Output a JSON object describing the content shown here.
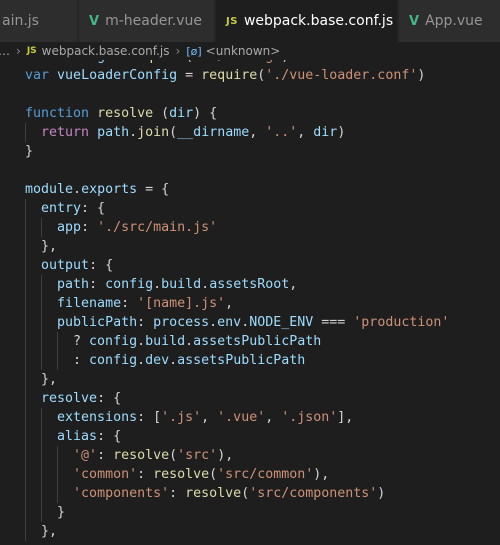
{
  "tabs": [
    {
      "label": "ain.js",
      "icon": "js-icon"
    },
    {
      "label": "m-header.vue",
      "icon": "vue-icon"
    },
    {
      "label": "webpack.base.conf.js",
      "icon": "js-icon",
      "active": true,
      "close": "✕"
    },
    {
      "label": "App.vue",
      "icon": "vue-icon"
    }
  ],
  "icons": {
    "js": "JS",
    "vue": "V"
  },
  "breadcrumb": {
    "lead": "…",
    "file": "webpack.base.conf.js",
    "symbol_icon": "[ø]",
    "symbol": "<unknown>"
  },
  "colors": {
    "keyword": "#569cd6",
    "control": "#c586c0",
    "function": "#dcdcaa",
    "variable": "#9cdcfe",
    "string": "#ce9178",
    "plain": "#d4d4d4",
    "background": "#1e1e1e"
  },
  "code_lines": [
    [
      [
        "k",
        "var"
      ],
      [
        "p",
        " "
      ],
      [
        "v",
        "config"
      ],
      [
        "p",
        " = "
      ],
      [
        "f",
        "require"
      ],
      [
        "p",
        "("
      ],
      [
        "s",
        "'../config'"
      ],
      [
        "p",
        ")"
      ]
    ],
    [
      [
        "k",
        "var"
      ],
      [
        "p",
        " "
      ],
      [
        "v",
        "vueLoaderConfig"
      ],
      [
        "p",
        " = "
      ],
      [
        "f",
        "require"
      ],
      [
        "p",
        "("
      ],
      [
        "s",
        "'./vue-loader.conf'"
      ],
      [
        "p",
        ")"
      ]
    ],
    [],
    [
      [
        "k",
        "function"
      ],
      [
        "p",
        " "
      ],
      [
        "f",
        "resolve"
      ],
      [
        "p",
        " ("
      ],
      [
        "v",
        "dir"
      ],
      [
        "p",
        ") {"
      ]
    ],
    [
      [
        "p",
        "  "
      ],
      [
        "c",
        "return"
      ],
      [
        "p",
        " "
      ],
      [
        "v",
        "path"
      ],
      [
        "p",
        "."
      ],
      [
        "f",
        "join"
      ],
      [
        "p",
        "("
      ],
      [
        "v",
        "__dirname"
      ],
      [
        "p",
        ", "
      ],
      [
        "s",
        "'..'"
      ],
      [
        "p",
        ", "
      ],
      [
        "v",
        "dir"
      ],
      [
        "p",
        ")"
      ]
    ],
    [
      [
        "p",
        "}"
      ]
    ],
    [],
    [
      [
        "v",
        "module"
      ],
      [
        "p",
        "."
      ],
      [
        "v",
        "exports"
      ],
      [
        "p",
        " = {"
      ]
    ],
    [
      [
        "p",
        "  "
      ],
      [
        "v",
        "entry"
      ],
      [
        "p",
        ": {"
      ]
    ],
    [
      [
        "p",
        "    "
      ],
      [
        "v",
        "app"
      ],
      [
        "p",
        ": "
      ],
      [
        "s",
        "'./src/main.js'"
      ]
    ],
    [
      [
        "p",
        "  },"
      ]
    ],
    [
      [
        "p",
        "  "
      ],
      [
        "v",
        "output"
      ],
      [
        "p",
        ": {"
      ]
    ],
    [
      [
        "p",
        "    "
      ],
      [
        "v",
        "path"
      ],
      [
        "p",
        ": "
      ],
      [
        "v",
        "config"
      ],
      [
        "p",
        "."
      ],
      [
        "v",
        "build"
      ],
      [
        "p",
        "."
      ],
      [
        "v",
        "assetsRoot"
      ],
      [
        "p",
        ","
      ]
    ],
    [
      [
        "p",
        "    "
      ],
      [
        "v",
        "filename"
      ],
      [
        "p",
        ": "
      ],
      [
        "s",
        "'[name].js'"
      ],
      [
        "p",
        ","
      ]
    ],
    [
      [
        "p",
        "    "
      ],
      [
        "v",
        "publicPath"
      ],
      [
        "p",
        ": "
      ],
      [
        "v",
        "process"
      ],
      [
        "p",
        "."
      ],
      [
        "v",
        "env"
      ],
      [
        "p",
        "."
      ],
      [
        "v",
        "NODE_ENV"
      ],
      [
        "p",
        " === "
      ],
      [
        "s",
        "'production'"
      ]
    ],
    [
      [
        "p",
        "      ? "
      ],
      [
        "v",
        "config"
      ],
      [
        "p",
        "."
      ],
      [
        "v",
        "build"
      ],
      [
        "p",
        "."
      ],
      [
        "v",
        "assetsPublicPath"
      ]
    ],
    [
      [
        "p",
        "      : "
      ],
      [
        "v",
        "config"
      ],
      [
        "p",
        "."
      ],
      [
        "v",
        "dev"
      ],
      [
        "p",
        "."
      ],
      [
        "v",
        "assetsPublicPath"
      ]
    ],
    [
      [
        "p",
        "  },"
      ]
    ],
    [
      [
        "p",
        "  "
      ],
      [
        "v",
        "resolve"
      ],
      [
        "p",
        ": {"
      ]
    ],
    [
      [
        "p",
        "    "
      ],
      [
        "v",
        "extensions"
      ],
      [
        "p",
        ": ["
      ],
      [
        "s",
        "'.js'"
      ],
      [
        "p",
        ", "
      ],
      [
        "s",
        "'.vue'"
      ],
      [
        "p",
        ", "
      ],
      [
        "s",
        "'.json'"
      ],
      [
        "p",
        "],"
      ]
    ],
    [
      [
        "p",
        "    "
      ],
      [
        "v",
        "alias"
      ],
      [
        "p",
        ": {"
      ]
    ],
    [
      [
        "p",
        "      "
      ],
      [
        "s",
        "'@'"
      ],
      [
        "p",
        ": "
      ],
      [
        "f",
        "resolve"
      ],
      [
        "p",
        "("
      ],
      [
        "s",
        "'src'"
      ],
      [
        "p",
        "),"
      ]
    ],
    [
      [
        "p",
        "      "
      ],
      [
        "s",
        "'common'"
      ],
      [
        "p",
        ": "
      ],
      [
        "f",
        "resolve"
      ],
      [
        "p",
        "("
      ],
      [
        "s",
        "'src/common'"
      ],
      [
        "p",
        "),"
      ]
    ],
    [
      [
        "p",
        "      "
      ],
      [
        "s",
        "'components'"
      ],
      [
        "p",
        ": "
      ],
      [
        "f",
        "resolve"
      ],
      [
        "p",
        "("
      ],
      [
        "s",
        "'src/components'"
      ],
      [
        "p",
        ")"
      ]
    ],
    [
      [
        "p",
        "    }"
      ]
    ],
    [
      [
        "p",
        "  },"
      ]
    ]
  ]
}
